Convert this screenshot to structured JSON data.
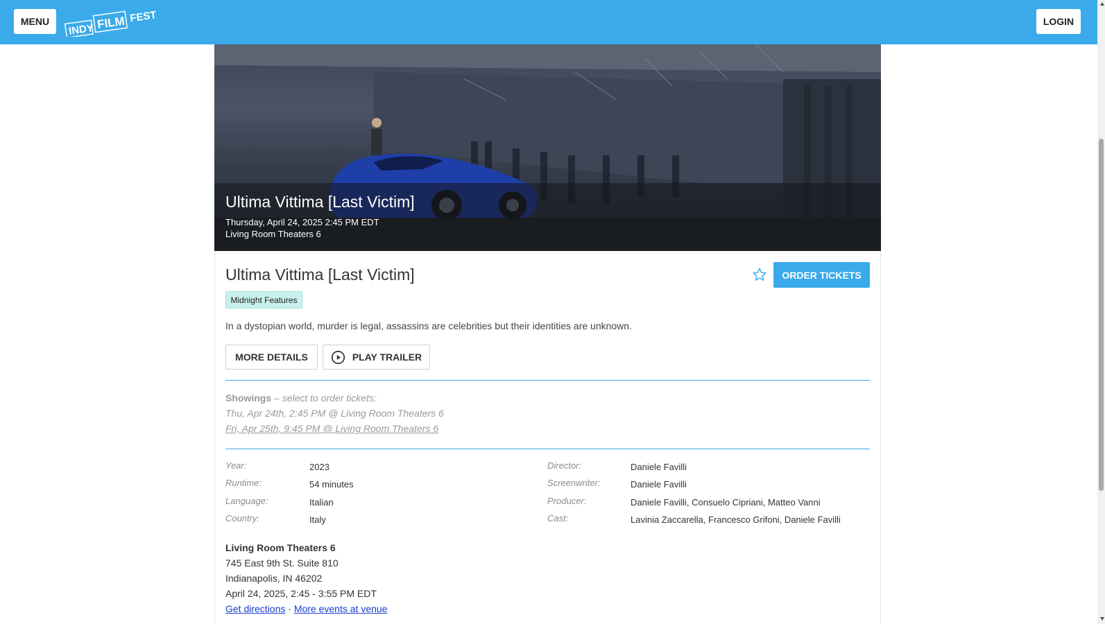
{
  "header": {
    "menu_label": "MENU",
    "logo_text": {
      "indy": "INDY",
      "film": "FILM",
      "fest": "FEST"
    },
    "login_label": "LOGIN",
    "color": "#3aaaea"
  },
  "hero": {
    "title": "Ultima Vittima [Last Victim]",
    "datetime": "Thursday, April 24, 2025 2:45 PM EDT",
    "venue": "Living Room Theaters 6"
  },
  "film": {
    "title": "Ultima Vittima [Last Victim]",
    "tag": "Midnight Features",
    "description": "In a dystopian world, murder is legal, assassins are celebrities but their identities are unknown.",
    "order_label": "ORDER TICKETS",
    "favorite_icon": "star-icon",
    "more_details_label": "MORE DETAILS",
    "play_trailer_label": "PLAY TRAILER"
  },
  "showings": {
    "heading": "Showings",
    "subheading": " – select to order tickets:",
    "items": [
      "Thu, Apr 24th, 2:45 PM @ Living Room Theaters 6",
      "Fri, Apr 25th, 9:45 PM @ Living Room Theaters 6"
    ]
  },
  "details": {
    "left": [
      {
        "label": "Year:",
        "value": "2023"
      },
      {
        "label": "Runtime:",
        "value": "54 minutes"
      },
      {
        "label": "Language:",
        "value": "Italian"
      },
      {
        "label": "Country:",
        "value": "Italy"
      }
    ],
    "right": [
      {
        "label": "Director:",
        "value": "Daniele Favilli"
      },
      {
        "label": "Screenwriter:",
        "value": "Daniele Favilli"
      },
      {
        "label": "Producer:",
        "value": "Daniele Favilli, Consuelo Cipriani, Matteo Vanni"
      },
      {
        "label": "Cast:",
        "value": "Lavinia Zaccarella, Francesco Grifoni, Daniele Favilli"
      }
    ]
  },
  "venue": {
    "name": "Living Room Theaters 6",
    "address": "745 East 9th St. Suite 810",
    "city": "Indianapolis, IN 46202",
    "time": "April 24, 2025, 2:45 - 3:55 PM EDT",
    "directions_label": "Get directions",
    "separator": " · ",
    "more_events_label": "More events at venue"
  }
}
